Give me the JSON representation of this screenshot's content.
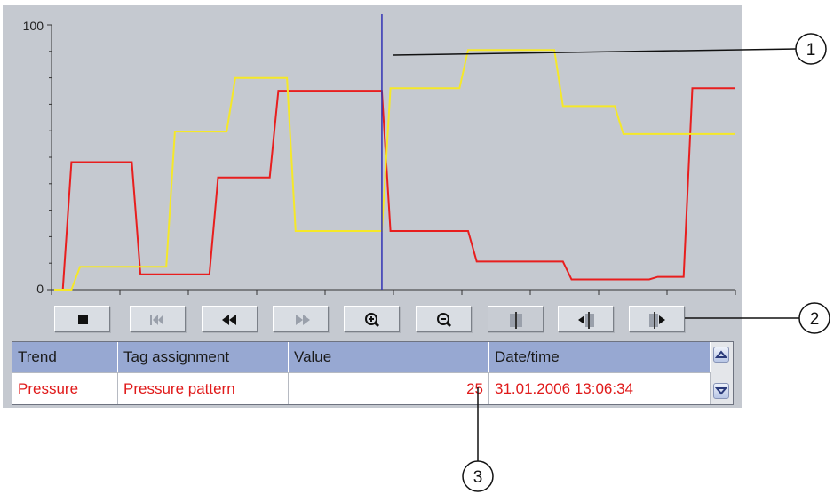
{
  "chart_data": {
    "type": "line",
    "y_axis": {
      "ticks": [
        0,
        100
      ],
      "ylim": [
        0,
        100
      ]
    },
    "series": [
      {
        "color": "#e81e1e",
        "points": [
          [
            0,
            0
          ],
          [
            1,
            0
          ],
          [
            2,
            50
          ],
          [
            9,
            50
          ],
          [
            10,
            6
          ],
          [
            18,
            6
          ],
          [
            19,
            44
          ],
          [
            25,
            44
          ],
          [
            26,
            78
          ],
          [
            38,
            78
          ],
          [
            39,
            23
          ],
          [
            48,
            23
          ],
          [
            49,
            11
          ],
          [
            59,
            11
          ],
          [
            60,
            4
          ],
          [
            69,
            4
          ],
          [
            70,
            5
          ],
          [
            73,
            5
          ],
          [
            74,
            79
          ],
          [
            79,
            79
          ]
        ]
      },
      {
        "color": "#f5e828",
        "points": [
          [
            0,
            0
          ],
          [
            2,
            0
          ],
          [
            3,
            9
          ],
          [
            13,
            9
          ],
          [
            14,
            62
          ],
          [
            20,
            62
          ],
          [
            21,
            83
          ],
          [
            27,
            83
          ],
          [
            28,
            23
          ],
          [
            38,
            23
          ],
          [
            39,
            79
          ],
          [
            47,
            79
          ],
          [
            48,
            94
          ],
          [
            58,
            94
          ],
          [
            59,
            72
          ],
          [
            65,
            72
          ],
          [
            66,
            61
          ],
          [
            79,
            61
          ]
        ]
      }
    ],
    "ruler": {
      "x": 38
    }
  },
  "toolbar": {
    "buttons": [
      {
        "icon": "stop-icon"
      },
      {
        "icon": "skip-to-start-icon"
      },
      {
        "icon": "rewind-icon"
      },
      {
        "icon": "fast-forward-icon"
      },
      {
        "icon": "zoom-in-icon"
      },
      {
        "icon": "zoom-out-icon"
      },
      {
        "icon": "ruler-icon"
      },
      {
        "icon": "previous-trend-icon"
      },
      {
        "icon": "next-trend-icon"
      }
    ]
  },
  "table": {
    "headers": [
      "Trend",
      "Tag assignment",
      "Value",
      "Date/time"
    ],
    "rows": [
      {
        "trend": "Pressure",
        "tag": "Pressure pattern",
        "value": "25",
        "datetime": "31.01.2006 13:06:34"
      }
    ]
  },
  "callouts": [
    "1",
    "2",
    "3"
  ],
  "colors": {
    "trend_background": "#c5c9d0",
    "header": "#97a8d2",
    "value_text": "#e01a1a",
    "ruler": "#3232b4"
  }
}
